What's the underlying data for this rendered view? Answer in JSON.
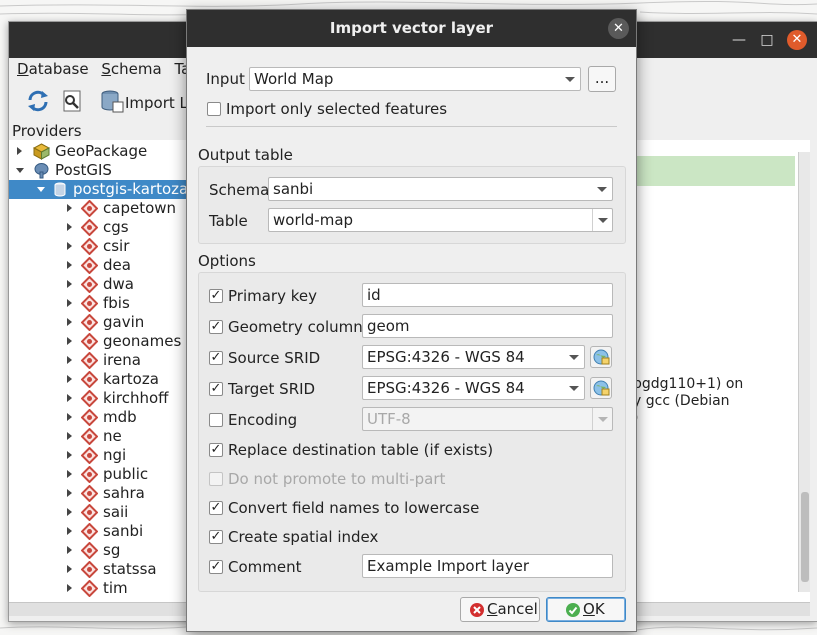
{
  "colors": {
    "title_bar": "#2f2f2f",
    "selection": "#3f89c7",
    "close_orange": "#e05b2b",
    "ok_green": "#4caf50",
    "cancel_red": "#d32f2f"
  },
  "db_manager": {
    "window_controls": {
      "minimize": "—",
      "maximize": "□",
      "close": "✕"
    },
    "menu": [
      {
        "underline": "D",
        "rest": "atabase"
      },
      {
        "underline": "S",
        "rest": "chema"
      },
      {
        "underline": "Tab",
        "rest": ""
      }
    ],
    "toolbar": {
      "import_label": "Import La"
    },
    "providers_header": "Providers",
    "tree": {
      "geopackage": "GeoPackage",
      "postgis": "PostGIS",
      "connection": "postgis-kartoza-c",
      "schemas": [
        "capetown",
        "cgs",
        "csir",
        "dea",
        "dwa",
        "fbis",
        "gavin",
        "geonames",
        "irena",
        "kartoza",
        "kirchhoff",
        "mdb",
        "ne",
        "ngi",
        "public",
        "sahra",
        "saii",
        "sanbi",
        "sg",
        "statssa",
        "tim"
      ]
    },
    "info_lines": [
      "pgdg110+1) on",
      "y gcc (Debian",
      ")"
    ]
  },
  "dialog": {
    "title": "Import vector layer",
    "close_icon": "✕",
    "input_label": "Input",
    "input_value": "World Map",
    "browse_label": "...",
    "import_selected_label": "Import only selected features",
    "output_table_header": "Output table",
    "schema_label": "Schema",
    "schema_value": "sanbi",
    "table_label": "Table",
    "table_value": "world-map",
    "options_header": "Options",
    "options": {
      "primary_key": {
        "label": "Primary key",
        "checked": true,
        "value": "id"
      },
      "geometry_column": {
        "label": "Geometry column",
        "checked": true,
        "value": "geom"
      },
      "source_srid": {
        "label": "Source SRID",
        "checked": true,
        "value": "EPSG:4326 - WGS 84"
      },
      "target_srid": {
        "label": "Target SRID",
        "checked": true,
        "value": "EPSG:4326 - WGS 84"
      },
      "encoding": {
        "label": "Encoding",
        "checked": false,
        "value": "UTF-8"
      },
      "replace_table": {
        "label": "Replace destination table (if exists)",
        "checked": true
      },
      "no_promote": {
        "label": "Do not promote to multi-part",
        "checked": false
      },
      "lowercase": {
        "label": "Convert field names to lowercase",
        "checked": true
      },
      "spatial_index": {
        "label": "Create spatial index",
        "checked": true
      },
      "comment": {
        "label": "Comment",
        "checked": true,
        "value": "Example Import layer"
      }
    },
    "check_mark": "✓",
    "cancel": {
      "underline": "C",
      "rest": "ancel"
    },
    "ok": {
      "underline": "O",
      "rest": "K"
    }
  }
}
